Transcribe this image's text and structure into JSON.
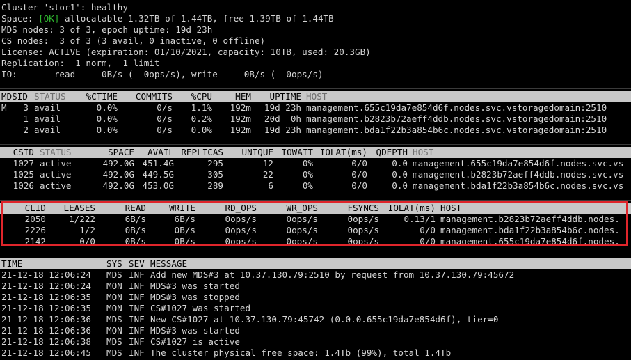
{
  "summary": [
    "Cluster 'stor1': healthy",
    {
      "prefix": "Space: ",
      "ok": "[OK]",
      "suffix": " allocatable 1.32TB of 1.44TB, free 1.39TB of 1.44TB"
    },
    "MDS nodes: 3 of 3, epoch uptime: 19d 23h",
    "CS nodes:  3 of 3 (3 avail, 0 inactive, 0 offline)",
    "License: ACTIVE (expiration: 01/10/2021, capacity: 10TB, used: 20.3GB)",
    "Replication:  1 norm,  1 limit",
    "IO:       read     0B/s (  0ops/s), write     0B/s (  0ops/s)"
  ],
  "mds": {
    "headers": {
      "id": "MDSID",
      "status": "STATUS",
      "ctime": "%CTIME",
      "commits": "COMMITS",
      "cpu": "%CPU",
      "mem": "MEM",
      "uptime": "UPTIME",
      "host": "HOST"
    },
    "rows": [
      {
        "master": "M",
        "id": "3",
        "status": "avail",
        "ctime": "0.0%",
        "commits": "0/s",
        "cpu": "1.1%",
        "mem": "192m",
        "uptime": "19d 23h",
        "host": "management.655c19da7e854d6f.nodes.svc.vstoragedomain:2510"
      },
      {
        "master": "",
        "id": "1",
        "status": "avail",
        "ctime": "0.0%",
        "commits": "0/s",
        "cpu": "0.2%",
        "mem": "192m",
        "uptime": "20d  0h",
        "host": "management.b2823b72aeff4ddb.nodes.svc.vstoragedomain:2510"
      },
      {
        "master": "",
        "id": "2",
        "status": "avail",
        "ctime": "0.0%",
        "commits": "0/s",
        "cpu": "0.0%",
        "mem": "192m",
        "uptime": "19d 23h",
        "host": "management.bda1f22b3a854b6c.nodes.svc.vstoragedomain:2510"
      }
    ]
  },
  "cs": {
    "headers": {
      "id": "CSID",
      "status": "STATUS",
      "space": "SPACE",
      "avail": "AVAIL",
      "replicas": "REPLICAS",
      "unique": "UNIQUE",
      "iowait": "IOWAIT",
      "iolat": "IOLAT(ms)",
      "qdepth": "QDEPTH",
      "host": "HOST"
    },
    "rows": [
      {
        "id": "1027",
        "status": "active",
        "space": "492.0G",
        "avail": "451.4G",
        "replicas": "295",
        "unique": "12",
        "iowait": "0%",
        "iolat": "0/0",
        "qdepth": "0.0",
        "host": "management.655c19da7e854d6f.nodes.svc.vs"
      },
      {
        "id": "1025",
        "status": "active",
        "space": "492.0G",
        "avail": "449.5G",
        "replicas": "305",
        "unique": "22",
        "iowait": "0%",
        "iolat": "0/0",
        "qdepth": "0.0",
        "host": "management.b2823b72aeff4ddb.nodes.svc.vs"
      },
      {
        "id": "1026",
        "status": "active",
        "space": "492.0G",
        "avail": "453.0G",
        "replicas": "289",
        "unique": "6",
        "iowait": "0%",
        "iolat": "0/0",
        "qdepth": "0.0",
        "host": "management.bda1f22b3a854b6c.nodes.svc.vs"
      }
    ]
  },
  "clients": {
    "headers": {
      "id": "CLID",
      "leases": "LEASES",
      "read": "READ",
      "write": "WRITE",
      "rdops": "RD_OPS",
      "wrops": "WR_OPS",
      "fsyncs": "FSYNCS",
      "iolat": "IOLAT(ms)",
      "host": "HOST"
    },
    "rows": [
      {
        "id": "2050",
        "leases": "1/222",
        "read": "6B/s",
        "write": "6B/s",
        "rdops": "0ops/s",
        "wrops": "0ops/s",
        "fsyncs": "0ops/s",
        "iolat": "0.13/1",
        "host": "management.b2823b72aeff4ddb.nodes."
      },
      {
        "id": "2226",
        "leases": "1/2",
        "read": "0B/s",
        "write": "0B/s",
        "rdops": "0ops/s",
        "wrops": "0ops/s",
        "fsyncs": "0ops/s",
        "iolat": "0/0",
        "host": "management.bda1f22b3a854b6c.nodes."
      },
      {
        "id": "2142",
        "leases": "0/0",
        "read": "0B/s",
        "write": "0B/s",
        "rdops": "0ops/s",
        "wrops": "0ops/s",
        "fsyncs": "0ops/s",
        "iolat": "0/0",
        "host": "management.655c19da7e854d6f.nodes."
      }
    ]
  },
  "events": {
    "headers": {
      "time": "TIME",
      "sys": "SYS",
      "sev": "SEV",
      "message": "MESSAGE"
    },
    "rows": [
      {
        "time": "21-12-18 12:06:24",
        "sys": "MDS",
        "sev": "INF",
        "message": "Add new MDS#3 at 10.37.130.79:2510 by request from 10.37.130.79:45672"
      },
      {
        "time": "21-12-18 12:06:24",
        "sys": "MON",
        "sev": "INF",
        "message": "MDS#3 was started"
      },
      {
        "time": "21-12-18 12:06:35",
        "sys": "MON",
        "sev": "INF",
        "message": "MDS#3 was stopped"
      },
      {
        "time": "21-12-18 12:06:35",
        "sys": "MON",
        "sev": "INF",
        "message": "CS#1027 was started"
      },
      {
        "time": "21-12-18 12:06:36",
        "sys": "MDS",
        "sev": "INF",
        "message": "New CS#1027 at 10.37.130.79:45742 (0.0.0.655c19da7e854d6f), tier=0"
      },
      {
        "time": "21-12-18 12:06:36",
        "sys": "MON",
        "sev": "INF",
        "message": "MDS#3 was started"
      },
      {
        "time": "21-12-18 12:06:38",
        "sys": "MDS",
        "sev": "INF",
        "message": "CS#1027 is active"
      },
      {
        "time": "21-12-18 12:06:45",
        "sys": "MDS",
        "sev": "INF",
        "message": "The cluster physical free space: 1.4Tb (99%), total 1.4Tb"
      }
    ]
  }
}
